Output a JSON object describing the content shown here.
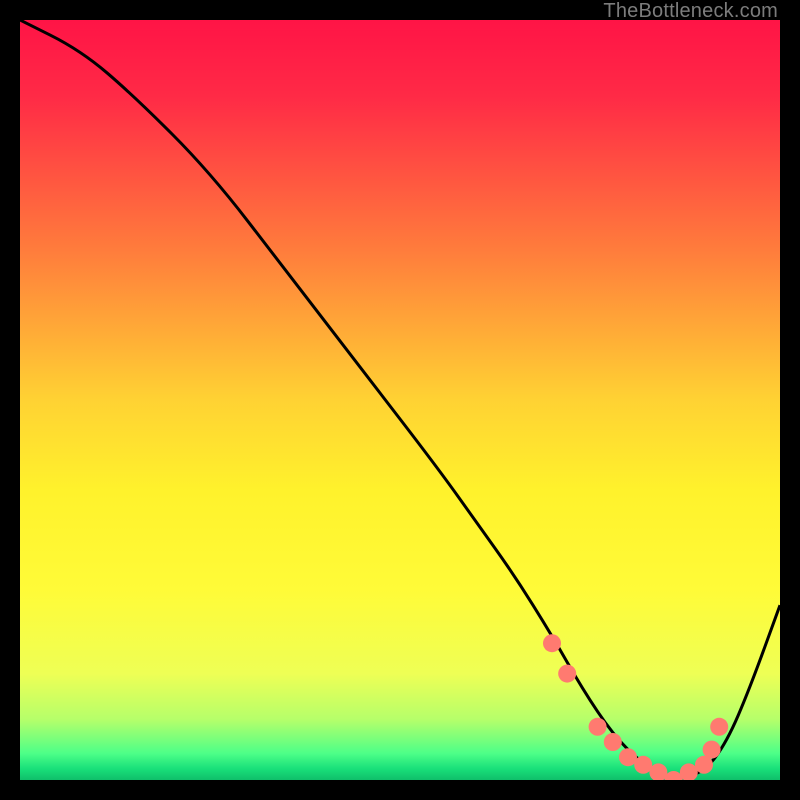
{
  "watermark": "TheBottleneck.com",
  "chart_data": {
    "type": "line",
    "title": "",
    "xlabel": "",
    "ylabel": "",
    "xlim": [
      0,
      100
    ],
    "ylim": [
      0,
      100
    ],
    "series": [
      {
        "name": "bottleneck-curve",
        "x": [
          0,
          8,
          15,
          25,
          35,
          45,
          55,
          60,
          65,
          70,
          74,
          78,
          82,
          86,
          90,
          93,
          96,
          100
        ],
        "values": [
          100,
          96,
          90,
          80,
          67,
          54,
          41,
          34,
          27,
          19,
          12,
          6,
          2,
          0,
          1,
          5,
          12,
          23
        ]
      }
    ],
    "markers": {
      "name": "optimal-zone-dots",
      "x": [
        70,
        72,
        76,
        78,
        80,
        82,
        84,
        86,
        88,
        90,
        91,
        92
      ],
      "values": [
        18,
        14,
        7,
        5,
        3,
        2,
        1,
        0,
        1,
        2,
        4,
        7
      ]
    },
    "gradient_stops": [
      {
        "offset": 0.0,
        "color": "#ff1446"
      },
      {
        "offset": 0.1,
        "color": "#ff2a46"
      },
      {
        "offset": 0.3,
        "color": "#ff7b3c"
      },
      {
        "offset": 0.5,
        "color": "#ffd233"
      },
      {
        "offset": 0.62,
        "color": "#fff22c"
      },
      {
        "offset": 0.75,
        "color": "#fffb38"
      },
      {
        "offset": 0.86,
        "color": "#eeff55"
      },
      {
        "offset": 0.92,
        "color": "#b6ff6a"
      },
      {
        "offset": 0.965,
        "color": "#4dff88"
      },
      {
        "offset": 0.985,
        "color": "#19e07a"
      },
      {
        "offset": 1.0,
        "color": "#0fbf6a"
      }
    ],
    "line_color": "#000000",
    "marker_color": "#ff7a70",
    "marker_radius": 9
  }
}
